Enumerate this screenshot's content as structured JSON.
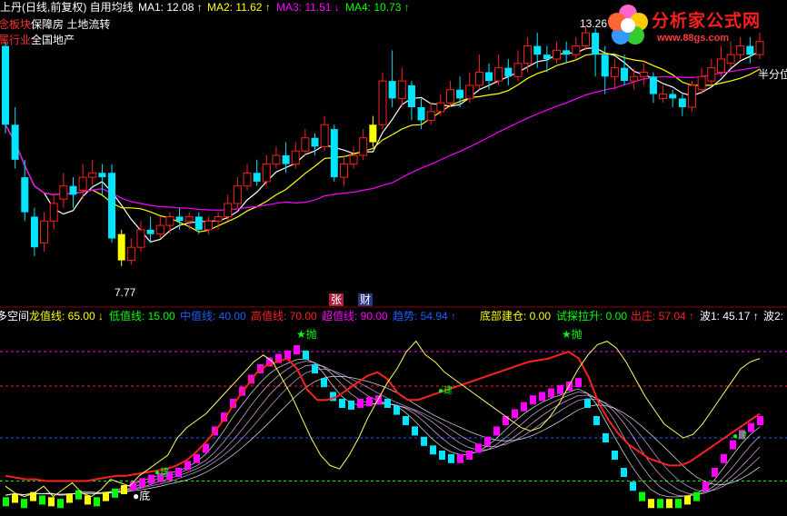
{
  "header": {
    "title": "上丹(日线,前复权) 自用均线",
    "ma": [
      {
        "label": "MA1: 12.08",
        "arrow": "↑",
        "color": "#ffffff"
      },
      {
        "label": "MA2: 11.62",
        "arrow": "↑",
        "color": "#ffff00"
      },
      {
        "label": "MA3: 11.51",
        "arrow": "↓",
        "color": "#ff00ff"
      },
      {
        "label": "MA4: 10.73",
        "arrow": "↑",
        "color": "#00ff00"
      }
    ],
    "sector_label": "概念板块:",
    "sector_value": "保障房 土地流转",
    "industry_label": "所属行业:",
    "industry_value": "全国地产"
  },
  "logo": {
    "name": "分析家公式网",
    "url": "www.88gs.com"
  },
  "price_annotations": {
    "high": "13.26",
    "low": "7.77",
    "right_tag": "半分位"
  },
  "markers": {
    "zhang": "张",
    "cai": "财"
  },
  "indicator_header": [
    {
      "text": "多空间",
      "color": "#ffffff"
    },
    {
      "text": "龙值线: 65.00",
      "arrow": "↓",
      "color": "#ffff00"
    },
    {
      "text": "低值线: 15.00",
      "color": "#00ff00"
    },
    {
      "text": "中值线: 40.00",
      "color": "#1a5cff"
    },
    {
      "text": "高值线: 70.00",
      "color": "#ff2020"
    },
    {
      "text": "超值线: 90.00",
      "color": "#ff00ff"
    },
    {
      "text": "趋势: 54.94",
      "arrow": "↑",
      "color": "#1a5cff"
    },
    {
      "text": "底部建仓: 0.00",
      "color": "#ffff00"
    },
    {
      "text": "试探拉升: 0.00",
      "color": "#00ff00"
    },
    {
      "text": "出庄: 57.04",
      "arrow": "↑",
      "color": "#ff2020"
    },
    {
      "text": "波1: 45.17",
      "arrow": "↑",
      "color": "#ffffff"
    },
    {
      "text": "波2:",
      "color": "#ffffff"
    }
  ],
  "signals": {
    "pao": "★抛",
    "di": "●底",
    "jian": "●建"
  },
  "chart_data": {
    "type": "candlestick",
    "price_ylim": [
      7.0,
      13.6
    ],
    "indicator_ylim": [
      0,
      100
    ],
    "candles": [
      [
        12.8,
        11.0,
        12.9,
        10.8
      ],
      [
        11.0,
        10.2,
        11.4,
        10.0
      ],
      [
        9.8,
        9.0,
        10.2,
        8.8
      ],
      [
        8.9,
        8.2,
        9.1,
        8.0
      ],
      [
        8.3,
        8.8,
        9.0,
        8.1
      ],
      [
        8.8,
        9.2,
        9.4,
        8.6
      ],
      [
        9.3,
        9.6,
        9.9,
        9.1
      ],
      [
        9.6,
        9.4,
        9.8,
        9.1
      ],
      [
        9.5,
        9.8,
        10.1,
        9.3
      ],
      [
        9.8,
        9.9,
        10.2,
        9.6
      ],
      [
        9.9,
        9.8,
        10.1,
        9.4
      ],
      [
        9.9,
        8.4,
        10.1,
        8.3
      ],
      [
        8.5,
        7.9,
        8.6,
        7.77
      ],
      [
        7.9,
        8.2,
        8.4,
        7.8
      ],
      [
        8.2,
        8.6,
        8.8,
        8.1
      ],
      [
        8.6,
        8.5,
        8.9,
        8.3
      ],
      [
        8.5,
        8.7,
        8.9,
        8.4
      ],
      [
        8.7,
        8.9,
        9.0,
        8.5
      ],
      [
        8.9,
        8.8,
        9.1,
        8.6
      ],
      [
        8.8,
        8.9,
        9.0,
        8.6
      ],
      [
        8.9,
        8.6,
        9.0,
        8.5
      ],
      [
        8.6,
        8.8,
        8.9,
        8.5
      ],
      [
        8.8,
        8.9,
        9.0,
        8.6
      ],
      [
        8.9,
        9.2,
        9.4,
        8.8
      ],
      [
        9.2,
        9.6,
        9.8,
        9.1
      ],
      [
        9.6,
        9.9,
        10.1,
        9.5
      ],
      [
        9.9,
        9.7,
        10.2,
        9.6
      ],
      [
        9.7,
        10.1,
        10.3,
        9.6
      ],
      [
        10.1,
        10.3,
        10.5,
        10.0
      ],
      [
        10.3,
        10.1,
        10.6,
        9.9
      ],
      [
        10.1,
        10.4,
        10.6,
        10.0
      ],
      [
        10.4,
        10.7,
        10.9,
        10.3
      ],
      [
        10.7,
        10.5,
        10.8,
        10.3
      ],
      [
        10.5,
        11.0,
        11.2,
        10.4
      ],
      [
        10.9,
        9.8,
        11.0,
        9.7
      ],
      [
        9.8,
        10.1,
        10.3,
        9.6
      ],
      [
        10.1,
        10.3,
        10.5,
        10.0
      ],
      [
        10.3,
        10.7,
        10.9,
        10.2
      ],
      [
        10.6,
        11.0,
        11.2,
        10.5
      ],
      [
        11.0,
        12.0,
        12.2,
        10.9
      ],
      [
        12.0,
        11.6,
        12.7,
        11.4
      ],
      [
        11.6,
        12.0,
        12.3,
        11.4
      ],
      [
        11.9,
        11.4,
        12.0,
        11.1
      ],
      [
        11.4,
        11.1,
        11.6,
        10.9
      ],
      [
        11.1,
        11.3,
        11.5,
        11.0
      ],
      [
        11.3,
        11.5,
        11.7,
        11.2
      ],
      [
        11.5,
        11.8,
        12.0,
        11.4
      ],
      [
        11.8,
        11.6,
        12.1,
        11.4
      ],
      [
        11.6,
        11.9,
        12.2,
        11.5
      ],
      [
        11.9,
        12.2,
        12.6,
        11.8
      ],
      [
        12.2,
        12.0,
        12.4,
        11.8
      ],
      [
        12.0,
        12.3,
        12.6,
        11.9
      ],
      [
        12.3,
        12.1,
        12.5,
        11.9
      ],
      [
        12.1,
        12.4,
        12.7,
        12.0
      ],
      [
        12.4,
        12.8,
        13.0,
        12.2
      ],
      [
        12.8,
        12.6,
        13.1,
        12.3
      ],
      [
        12.6,
        12.5,
        12.8,
        12.2
      ],
      [
        12.5,
        12.7,
        12.9,
        12.4
      ],
      [
        12.7,
        12.6,
        12.9,
        12.4
      ],
      [
        12.6,
        12.8,
        13.0,
        12.5
      ],
      [
        12.8,
        13.1,
        13.26,
        12.7
      ],
      [
        13.1,
        12.6,
        13.2,
        12.1
      ],
      [
        12.6,
        12.1,
        12.8,
        11.7
      ],
      [
        12.1,
        12.3,
        12.5,
        11.8
      ],
      [
        12.3,
        12.0,
        12.6,
        11.9
      ],
      [
        12.0,
        12.1,
        12.3,
        11.8
      ],
      [
        12.1,
        12.2,
        12.4,
        11.9
      ],
      [
        12.1,
        11.7,
        12.2,
        11.5
      ],
      [
        11.6,
        11.7,
        11.9,
        11.5
      ],
      [
        11.7,
        11.6,
        11.8,
        11.4
      ],
      [
        11.6,
        11.4,
        11.7,
        11.2
      ],
      [
        11.4,
        11.9,
        12.0,
        11.3
      ],
      [
        11.8,
        12.1,
        12.3,
        11.7
      ],
      [
        12.0,
        12.3,
        12.5,
        11.9
      ],
      [
        12.2,
        12.5,
        12.8,
        12.1
      ],
      [
        12.4,
        12.6,
        12.9,
        12.3
      ],
      [
        12.6,
        12.8,
        13.0,
        12.5
      ],
      [
        12.8,
        12.6,
        13.0,
        12.4
      ],
      [
        12.6,
        12.9,
        13.1,
        12.5
      ]
    ],
    "chart_overlays": {
      "ma": [
        {
          "name": "MA1",
          "color": "#ffffff"
        },
        {
          "name": "MA2",
          "color": "#ffff00"
        },
        {
          "name": "MA3",
          "color": "#ff00ff"
        }
      ],
      "yellow_bars": [
        12,
        38
      ]
    },
    "indicator": {
      "ref_lines": [
        {
          "value": 90,
          "color": "#ff00ff",
          "style": "dashed"
        },
        {
          "value": 70,
          "color": "#ff2020",
          "style": "dashed"
        },
        {
          "value": 40,
          "color": "#1a5cff",
          "style": "dashed"
        },
        {
          "value": 15,
          "color": "#00ff00",
          "style": "dashed"
        }
      ],
      "bars": [
        3,
        5,
        2,
        6,
        4,
        3,
        2,
        5,
        7,
        4,
        3,
        6,
        8,
        10,
        12,
        14,
        16,
        17,
        18,
        20,
        24,
        28,
        34,
        44,
        52,
        60,
        67,
        74,
        80,
        84,
        86,
        88,
        91,
        88,
        80,
        72,
        64,
        60,
        59,
        60,
        61,
        62,
        60,
        56,
        50,
        44,
        38,
        33,
        30,
        28,
        28,
        30,
        34,
        38,
        44,
        50,
        54,
        58,
        62,
        64,
        66,
        68,
        70,
        72,
        60,
        50,
        40,
        30,
        20,
        12,
        6,
        2,
        2,
        2,
        2,
        4,
        6,
        12,
        20,
        28,
        36,
        42,
        46,
        50
      ],
      "red_line": [
        18,
        17,
        16,
        16,
        15,
        15,
        15,
        15,
        15,
        16,
        17,
        18,
        18,
        19,
        20,
        21,
        22,
        24,
        27,
        32,
        38,
        45,
        53,
        62,
        70,
        78,
        82,
        84,
        86,
        80,
        68,
        62,
        62,
        64,
        68,
        72,
        76,
        78,
        74,
        66,
        62,
        62,
        64,
        66,
        68,
        70,
        72,
        74,
        76,
        78,
        80,
        82,
        84,
        85,
        86,
        88,
        90,
        86,
        75,
        60,
        50,
        42,
        36,
        32,
        28,
        26,
        24,
        24,
        26,
        30,
        34,
        38,
        42,
        46,
        50,
        54
      ],
      "yellow_line": [
        12,
        8,
        6,
        8,
        12,
        6,
        10,
        14,
        8,
        6,
        10,
        16,
        14,
        12,
        18,
        22,
        26,
        30,
        40,
        46,
        50,
        54,
        60,
        66,
        72,
        78,
        84,
        88,
        84,
        74,
        64,
        52,
        40,
        30,
        24,
        22,
        30,
        40,
        52,
        62,
        72,
        80,
        90,
        96,
        88,
        84,
        78,
        74,
        70,
        66,
        62,
        58,
        54,
        50,
        46,
        44,
        46,
        52,
        60,
        70,
        80,
        88,
        94,
        96,
        92,
        84,
        74,
        64,
        56,
        48,
        44,
        40,
        42,
        48,
        56,
        64,
        72,
        80,
        84,
        86
      ]
    }
  }
}
